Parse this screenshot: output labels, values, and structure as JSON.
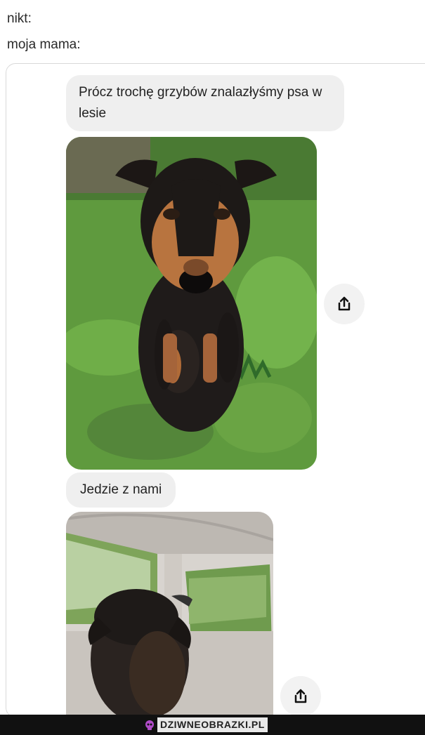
{
  "caption": {
    "line1": "nikt:",
    "line2": "moja mama:"
  },
  "messages": [
    {
      "text": "Prócz trochę grzybów znalazłyśmy psa w lesie"
    },
    {
      "text": "Jedzie z nami"
    }
  ],
  "icons": {
    "share": "share-icon",
    "logo": "skull-icon"
  },
  "watermark": {
    "text": "DZIWNEOBRAZKI.PL",
    "color": "#b04cc8"
  }
}
